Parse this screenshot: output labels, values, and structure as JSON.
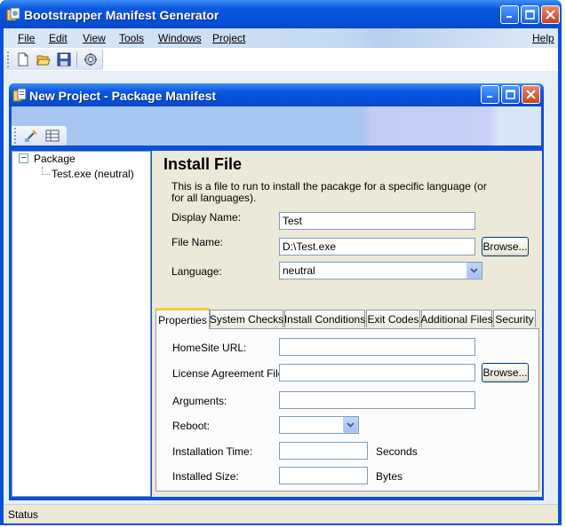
{
  "window": {
    "title": "Bootstrapper Manifest Generator"
  },
  "menu": {
    "items": [
      {
        "label": "File"
      },
      {
        "label": "Edit"
      },
      {
        "label": "View"
      },
      {
        "label": "Tools"
      },
      {
        "label": "Windows"
      },
      {
        "label": "Project"
      },
      {
        "label": "Help"
      }
    ]
  },
  "toolbar": {
    "icons": [
      "new-document-icon",
      "open-folder-icon",
      "save-icon",
      "build-icon"
    ]
  },
  "child_window": {
    "title": "New Project - Package Manifest",
    "toolbar_icons": [
      "edit-wizard-icon",
      "properties-grid-icon"
    ]
  },
  "tree": {
    "root_label": "Package",
    "expander": "⊟",
    "children": [
      {
        "label": "Test.exe (neutral)"
      }
    ]
  },
  "install_file": {
    "heading": "Install File",
    "description": "This is a file to run to install the pacakge for a specific language (or for all languages).",
    "display_name_label": "Display Name:",
    "display_name_value": "Test",
    "file_name_label": "File Name:",
    "file_name_value": "D:\\Test.exe",
    "browse_label": "Browse...",
    "language_label": "Language:",
    "language_value": "neutral"
  },
  "tabs": [
    {
      "label": "Properties",
      "active": true
    },
    {
      "label": "System Checks"
    },
    {
      "label": "Install Conditions"
    },
    {
      "label": "Exit Codes"
    },
    {
      "label": "Additional Files"
    },
    {
      "label": "Security"
    }
  ],
  "properties": {
    "homesite_label": "HomeSite URL:",
    "homesite_value": "",
    "license_label": "License Agreement File:",
    "license_value": "",
    "license_browse_label": "Browse...",
    "arguments_label": "Arguments:",
    "arguments_value": "",
    "reboot_label": "Reboot:",
    "reboot_value": "",
    "install_time_label": "Installation Time:",
    "install_time_value": "",
    "install_time_unit": "Seconds",
    "installed_size_label": "Installed Size:",
    "installed_size_value": "",
    "installed_size_unit": "Bytes"
  },
  "status": {
    "text": "Status"
  },
  "colors": {
    "titlebar_blue": "#0a50d8",
    "menu_band": "#c5d9f3",
    "panel_beige": "#ece9d8",
    "active_tab_accent": "#ffc83c"
  }
}
